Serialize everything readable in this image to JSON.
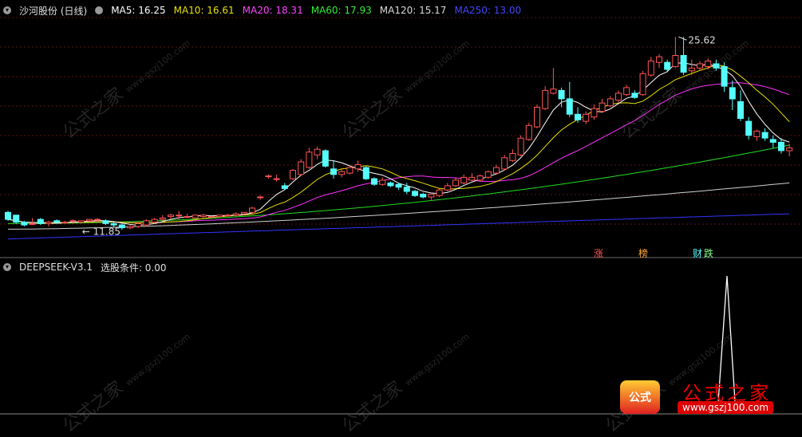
{
  "header": {
    "stock_name": "沙河股份 (日线)",
    "ma5": "MA5: 16.25",
    "ma10": "MA10: 16.61",
    "ma20": "MA20: 18.31",
    "ma60": "MA60: 17.93",
    "ma120": "MA120: 15.17",
    "ma250": "MA250: 13.00"
  },
  "colors": {
    "ma5": "#ffffff",
    "ma10": "#e8e000",
    "ma20": "#ff33ff",
    "ma60": "#22dd22",
    "ma120": "#d0d0d0",
    "ma250": "#3333ff",
    "up_candle": "#ff5555",
    "down_candle": "#55ffff"
  },
  "indicator": {
    "name": "DEEPSEEK-V3.1",
    "condition": "选股条件: 0.00"
  },
  "annotations": {
    "high": "25.62",
    "low": "11.85",
    "tag_zhang": "涨",
    "tag_bang": "榜",
    "tag_caibao": "财",
    "tag_die": "跌"
  },
  "watermark": {
    "text": "公式之家",
    "url": "www.gszj100.com"
  },
  "logo": {
    "icon_text": "公式",
    "title": "公式之家",
    "url": "www.gszj100.com"
  },
  "chart_data": {
    "type": "candlestick",
    "y_range": [
      10.5,
      27
    ],
    "candles": [
      [
        13.1,
        13.2,
        12.6,
        12.5
      ],
      [
        12.9,
        12.9,
        12.4,
        12.3
      ],
      [
        12.4,
        12.5,
        12.2,
        12.1
      ],
      [
        12.3,
        12.7,
        12.3,
        12.2
      ],
      [
        12.6,
        12.7,
        12.3,
        12.2
      ],
      [
        12.3,
        12.5,
        12.4,
        12.1
      ],
      [
        12.5,
        12.6,
        12.4,
        12.3
      ],
      [
        12.4,
        12.5,
        12.4,
        12.3
      ],
      [
        12.5,
        12.6,
        12.5,
        12.3
      ],
      [
        12.4,
        12.5,
        12.5,
        12.3
      ],
      [
        12.5,
        12.6,
        12.6,
        12.4
      ],
      [
        12.6,
        12.7,
        12.6,
        12.4
      ],
      [
        12.5,
        12.6,
        12.3,
        12.2
      ],
      [
        12.3,
        12.4,
        12.2,
        12.0
      ],
      [
        12.2,
        12.3,
        12.0,
        11.85
      ],
      [
        12.0,
        12.2,
        12.1,
        11.9
      ],
      [
        12.1,
        12.4,
        12.3,
        12.0
      ],
      [
        12.2,
        12.6,
        12.5,
        12.1
      ],
      [
        12.4,
        12.7,
        12.6,
        12.3
      ],
      [
        12.6,
        12.9,
        12.7,
        12.5
      ],
      [
        12.8,
        13.0,
        12.9,
        12.6
      ],
      [
        12.9,
        13.2,
        12.9,
        12.6
      ],
      [
        12.8,
        13.0,
        12.8,
        12.7
      ],
      [
        12.7,
        12.9,
        12.9,
        12.6
      ],
      [
        12.8,
        13.0,
        12.9,
        12.7
      ],
      [
        12.8,
        12.9,
        12.8,
        12.7
      ],
      [
        12.8,
        12.9,
        12.9,
        12.7
      ],
      [
        12.9,
        13.0,
        12.9,
        12.8
      ],
      [
        12.9,
        13.1,
        13.0,
        12.8
      ],
      [
        13.0,
        13.1,
        13.1,
        12.9
      ],
      [
        13.1,
        13.5,
        13.4,
        13.0
      ],
      [
        14.2,
        14.3,
        14.2,
        14.0
      ],
      [
        15.7,
        15.8,
        15.7,
        15.5
      ],
      [
        15.5,
        15.8,
        15.5,
        15.3
      ],
      [
        15.0,
        15.2,
        14.8,
        14.7
      ],
      [
        15.5,
        16.2,
        16.1,
        15.4
      ],
      [
        15.8,
        16.9,
        16.7,
        15.7
      ],
      [
        16.3,
        17.7,
        17.4,
        16.2
      ],
      [
        17.2,
        17.8,
        17.6,
        16.9
      ],
      [
        17.5,
        17.6,
        16.4,
        16.3
      ],
      [
        16.2,
        16.8,
        15.8,
        15.5
      ],
      [
        15.8,
        16.2,
        16.0,
        15.6
      ],
      [
        15.9,
        16.5,
        16.3,
        15.8
      ],
      [
        16.2,
        16.8,
        16.5,
        16.0
      ],
      [
        16.3,
        16.4,
        15.5,
        15.4
      ],
      [
        15.5,
        15.6,
        15.1,
        15.0
      ],
      [
        15.1,
        15.6,
        15.4,
        15.0
      ],
      [
        15.2,
        15.3,
        15.0,
        14.9
      ],
      [
        15.1,
        15.2,
        14.9,
        14.7
      ],
      [
        14.9,
        15.2,
        14.6,
        14.4
      ],
      [
        14.6,
        14.7,
        14.3,
        14.2
      ],
      [
        14.4,
        14.5,
        14.2,
        14.1
      ],
      [
        14.2,
        14.4,
        14.4,
        14.0
      ],
      [
        14.3,
        14.8,
        14.7,
        14.2
      ],
      [
        14.7,
        15.2,
        15.0,
        14.6
      ],
      [
        15.0,
        15.6,
        15.4,
        14.9
      ],
      [
        15.2,
        15.8,
        15.6,
        15.1
      ],
      [
        15.4,
        15.9,
        15.6,
        15.3
      ],
      [
        15.4,
        15.8,
        15.7,
        15.3
      ],
      [
        15.6,
        16.1,
        16.0,
        15.5
      ],
      [
        15.9,
        16.5,
        16.3,
        15.8
      ],
      [
        16.2,
        17.2,
        17.0,
        16.1
      ],
      [
        16.8,
        17.6,
        17.3,
        16.7
      ],
      [
        17.2,
        18.6,
        18.4,
        17.1
      ],
      [
        18.3,
        19.5,
        19.3,
        18.2
      ],
      [
        19.2,
        20.8,
        20.6,
        19.1
      ],
      [
        20.5,
        22.1,
        21.8,
        20.4
      ],
      [
        21.6,
        23.4,
        21.9,
        21.5
      ],
      [
        21.8,
        22.0,
        21.2,
        20.6
      ],
      [
        21.2,
        22.4,
        20.1,
        19.9
      ],
      [
        20.1,
        20.6,
        19.7,
        19.5
      ],
      [
        19.6,
        20.3,
        20.1,
        19.4
      ],
      [
        19.9,
        20.8,
        20.5,
        19.7
      ],
      [
        20.3,
        21.2,
        20.9,
        20.2
      ],
      [
        20.7,
        21.4,
        21.2,
        20.6
      ],
      [
        21.1,
        21.8,
        21.6,
        20.9
      ],
      [
        21.5,
        22.2,
        22.0,
        21.4
      ],
      [
        21.6,
        21.8,
        21.3,
        21.2
      ],
      [
        21.5,
        23.2,
        23.0,
        21.4
      ],
      [
        22.9,
        24.2,
        23.9,
        22.8
      ],
      [
        23.8,
        24.4,
        24.2,
        23.4
      ],
      [
        23.8,
        24.0,
        23.3,
        23.1
      ],
      [
        23.5,
        25.62,
        24.3,
        23.4
      ],
      [
        24.3,
        25.62,
        23.1,
        22.9
      ],
      [
        23.2,
        24.0,
        23.4,
        22.9
      ],
      [
        23.4,
        23.9,
        23.7,
        23.2
      ],
      [
        23.5,
        24.1,
        23.9,
        23.3
      ],
      [
        23.7,
        24.0,
        23.4,
        23.2
      ],
      [
        23.5,
        23.8,
        22.1,
        21.7
      ],
      [
        22.0,
        22.5,
        21.2,
        20.4
      ],
      [
        21.0,
        21.8,
        19.8,
        19.6
      ],
      [
        19.6,
        19.9,
        18.6,
        18.3
      ],
      [
        18.5,
        19.0,
        18.9,
        18.2
      ],
      [
        18.8,
        19.1,
        18.4,
        18.2
      ],
      [
        18.3,
        18.6,
        18.1,
        17.7
      ],
      [
        18.1,
        18.4,
        17.5,
        17.3
      ],
      [
        17.5,
        18.0,
        17.7,
        17.1
      ]
    ]
  }
}
